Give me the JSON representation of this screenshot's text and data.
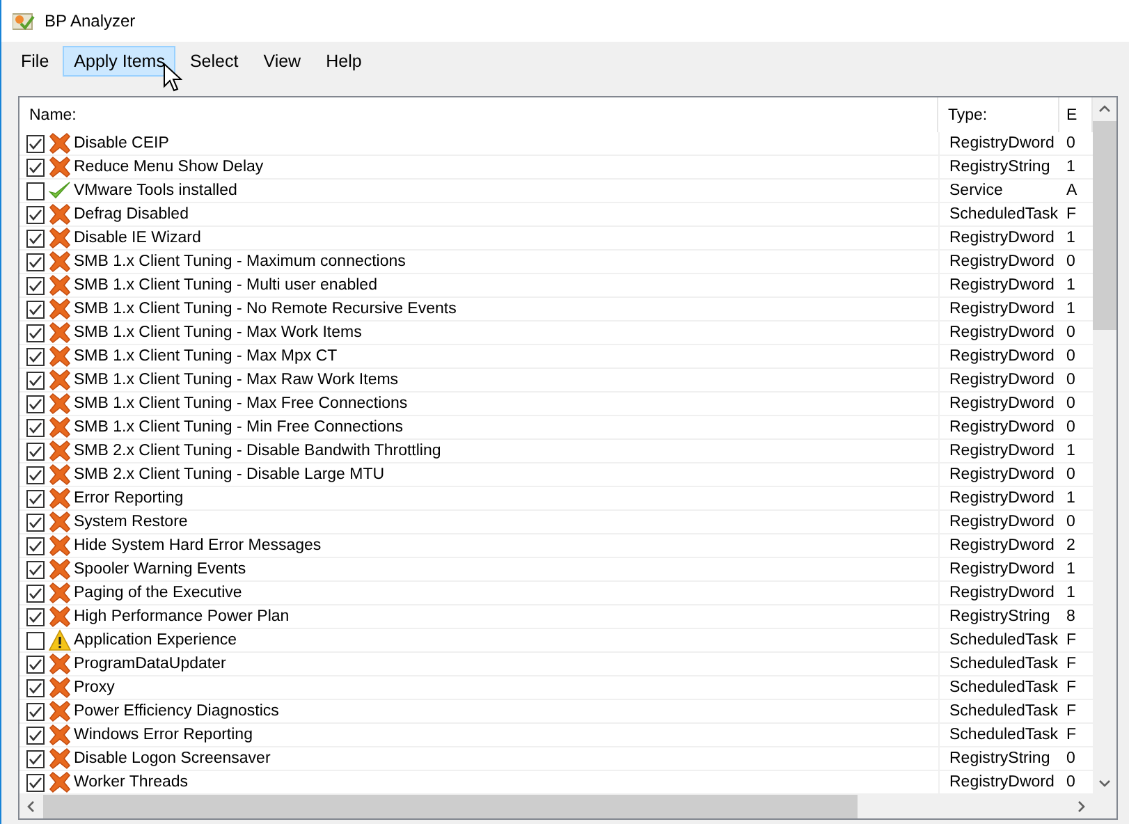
{
  "window": {
    "title": "BP Analyzer"
  },
  "menu": [
    {
      "label": "File",
      "highlighted": false
    },
    {
      "label": "Apply Items",
      "highlighted": true
    },
    {
      "label": "Select",
      "highlighted": false
    },
    {
      "label": "View",
      "highlighted": false
    },
    {
      "label": "Help",
      "highlighted": false
    }
  ],
  "list": {
    "columns": [
      "Name:",
      "Type:",
      "E"
    ],
    "rows": [
      {
        "checked": true,
        "kind": "fail",
        "name": "Disable CEIP",
        "type": "RegistryDword",
        "column_3": "0"
      },
      {
        "checked": true,
        "kind": "fail",
        "name": "Reduce Menu Show Delay",
        "type": "RegistryString",
        "column_3": "1"
      },
      {
        "checked": false,
        "kind": "pass",
        "name": "VMware Tools installed",
        "type": "Service",
        "column_3": "A"
      },
      {
        "checked": true,
        "kind": "fail",
        "name": "Defrag Disabled",
        "type": "ScheduledTask",
        "column_3": "F"
      },
      {
        "checked": true,
        "kind": "fail",
        "name": "Disable IE Wizard",
        "type": "RegistryDword",
        "column_3": "1"
      },
      {
        "checked": true,
        "kind": "fail",
        "name": "SMB 1.x Client Tuning - Maximum connections",
        "type": "RegistryDword",
        "column_3": "0"
      },
      {
        "checked": true,
        "kind": "fail",
        "name": "SMB 1.x Client Tuning - Multi user enabled",
        "type": "RegistryDword",
        "column_3": "1"
      },
      {
        "checked": true,
        "kind": "fail",
        "name": "SMB 1.x Client Tuning - No Remote Recursive Events",
        "type": "RegistryDword",
        "column_3": "1"
      },
      {
        "checked": true,
        "kind": "fail",
        "name": "SMB 1.x Client Tuning - Max Work Items",
        "type": "RegistryDword",
        "column_3": "0"
      },
      {
        "checked": true,
        "kind": "fail",
        "name": "SMB 1.x Client Tuning - Max Mpx CT",
        "type": "RegistryDword",
        "column_3": "0"
      },
      {
        "checked": true,
        "kind": "fail",
        "name": "SMB 1.x Client Tuning - Max Raw Work Items",
        "type": "RegistryDword",
        "column_3": "0"
      },
      {
        "checked": true,
        "kind": "fail",
        "name": "SMB 1.x Client Tuning - Max Free Connections",
        "type": "RegistryDword",
        "column_3": "0"
      },
      {
        "checked": true,
        "kind": "fail",
        "name": "SMB 1.x Client Tuning - Min Free Connections",
        "type": "RegistryDword",
        "column_3": "0"
      },
      {
        "checked": true,
        "kind": "fail",
        "name": "SMB 2.x Client Tuning - Disable Bandwith Throttling",
        "type": "RegistryDword",
        "column_3": "1"
      },
      {
        "checked": true,
        "kind": "fail",
        "name": "SMB 2.x Client Tuning - Disable Large MTU",
        "type": "RegistryDword",
        "column_3": "0"
      },
      {
        "checked": true,
        "kind": "fail",
        "name": "Error Reporting",
        "type": "RegistryDword",
        "column_3": "1"
      },
      {
        "checked": true,
        "kind": "fail",
        "name": "System Restore",
        "type": "RegistryDword",
        "column_3": "0"
      },
      {
        "checked": true,
        "kind": "fail",
        "name": "Hide System Hard Error Messages",
        "type": "RegistryDword",
        "column_3": "2"
      },
      {
        "checked": true,
        "kind": "fail",
        "name": "Spooler Warning Events",
        "type": "RegistryDword",
        "column_3": "1"
      },
      {
        "checked": true,
        "kind": "fail",
        "name": "Paging of the Executive",
        "type": "RegistryDword",
        "column_3": "1"
      },
      {
        "checked": true,
        "kind": "fail",
        "name": "High Performance Power Plan",
        "type": "RegistryString",
        "column_3": "8"
      },
      {
        "checked": false,
        "kind": "warning",
        "name": "Application Experience",
        "type": "ScheduledTask",
        "column_3": "F"
      },
      {
        "checked": true,
        "kind": "fail",
        "name": "ProgramDataUpdater",
        "type": "ScheduledTask",
        "column_3": "F"
      },
      {
        "checked": true,
        "kind": "fail",
        "name": "Proxy",
        "type": "ScheduledTask",
        "column_3": "F"
      },
      {
        "checked": true,
        "kind": "fail",
        "name": "Power Efficiency Diagnostics",
        "type": "ScheduledTask",
        "column_3": "F"
      },
      {
        "checked": true,
        "kind": "fail",
        "name": "Windows Error Reporting",
        "type": "ScheduledTask",
        "column_3": "F"
      },
      {
        "checked": true,
        "kind": "fail",
        "name": "Disable Logon Screensaver",
        "type": "RegistryString",
        "column_3": "0"
      },
      {
        "checked": true,
        "kind": "fail",
        "name": "Worker Threads",
        "type": "RegistryDword",
        "column_3": "0"
      }
    ]
  }
}
